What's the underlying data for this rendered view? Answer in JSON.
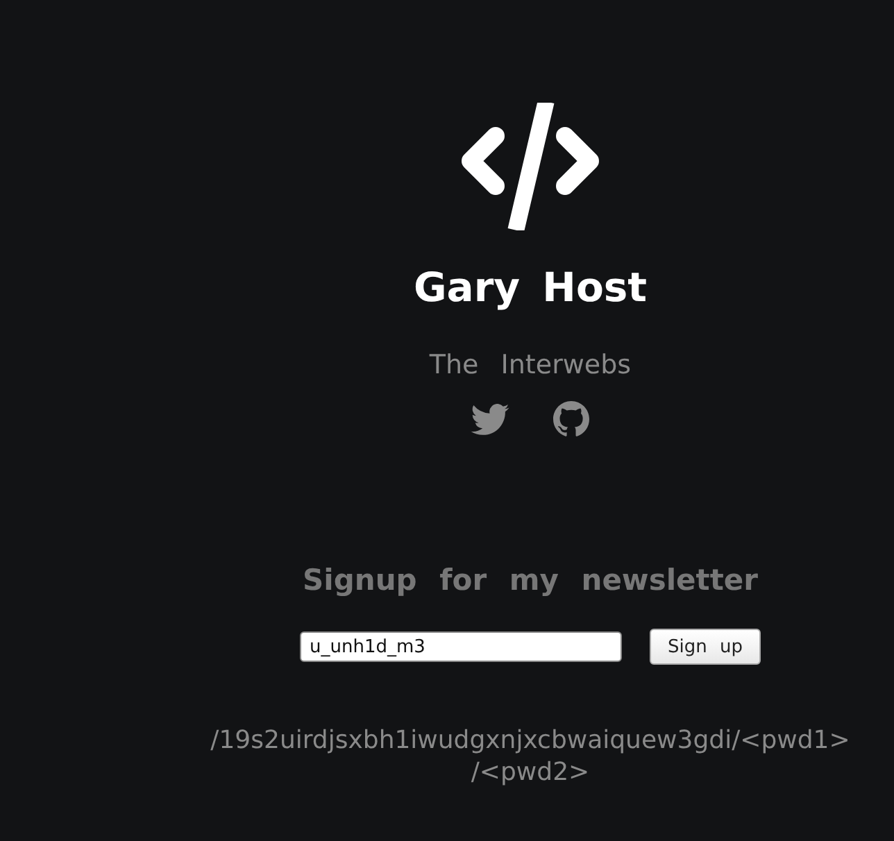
{
  "site_title": "Gary Host",
  "subtitle": "The Interwebs",
  "newsletter": {
    "heading": "Signup for my newsletter",
    "input_value": "u_unh1d_m3",
    "button": "Sign up"
  },
  "path": "/19s2uirdjsxbh1iwudgxnjxcbwaiquew3gdi/<pwd1>/<pwd2>"
}
